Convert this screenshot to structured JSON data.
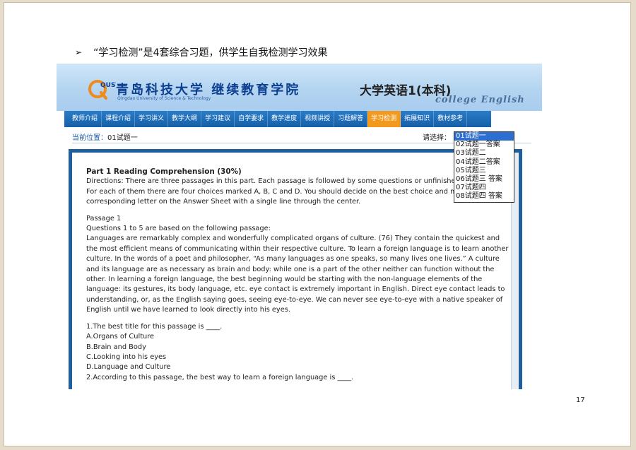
{
  "slide": {
    "bullet_glyph": "➢",
    "bullet_text": "“学习检测”是4套综合习题，供学生自我检测学习效果",
    "page_number": "17"
  },
  "banner": {
    "logo_mark": "QUST",
    "logo_cn": "青岛科技大学 继续教育学院",
    "logo_en": "Qingdao University of Science & Technology",
    "course_title": "大学英语1(本科)",
    "course_en": "college English"
  },
  "nav": {
    "items": [
      "教师介绍",
      "课程介绍",
      "学习讲义",
      "教学大纲",
      "学习建议",
      "自学要求",
      "教学进度",
      "视频讲授",
      "习题解答",
      "学习检测",
      "拓展知识",
      "教材参考"
    ],
    "active": "学习检测"
  },
  "location": {
    "label": "当前位置：",
    "value": "01试题一",
    "select_label": "请选择："
  },
  "dropdown": {
    "options": [
      "01试题一",
      "02试题一答案",
      "03试题二",
      "04试题二答案",
      "05试题三",
      "06试题三  答案",
      "07试题四",
      "08试题四  答案"
    ],
    "selected": "01试题一"
  },
  "content": {
    "part_heading": "Part 1   Reading Comprehension  (30%)",
    "directions": [
      "Directions:  There are three passages in this part. Each passage is followed by some questions or unfinished s",
      "For each of them there are four choices marked A, B, C and D. You should decide on the best choice and mar",
      "corresponding letter on the Answer Sheet with a single line through the center."
    ],
    "passage_title": "Passage 1",
    "passage_intro": "Questions 1 to 5 are based on the following passage:",
    "passage_lines": [
      "Languages are remarkably complex and wonderfully complicated organs of culture. (76) They contain the quickest and",
      "the most efficient means of communicating within their respective culture. To learn a foreign language is to learn another",
      "culture. In the words of a poet and philosopher, “As many languages as one speaks, so many lives one lives.” A culture",
      "and its language are as necessary as brain and body: while one is a part of the other neither can function without the",
      "other. In learning a foreign language, the best beginning would be starting with the non-language elements of the",
      "language: its gestures, its body language, etc. eye contact is extremely important in English. Direct eye contact leads to",
      "understanding, or, as the English saying goes, seeing eye-to-eye. We can never see eye-to-eye with a native speaker of",
      "English until we have learned to look directly into his eyes."
    ],
    "question1": "1.The best title for this passage is ____.",
    "q1_options": [
      "A.Organs of Culture",
      "B.Brain and Body",
      "C.Looking into his eyes",
      "D.Language and Culture"
    ],
    "question2": "2.According to this passage, the best way to learn a foreign language is ____."
  }
}
